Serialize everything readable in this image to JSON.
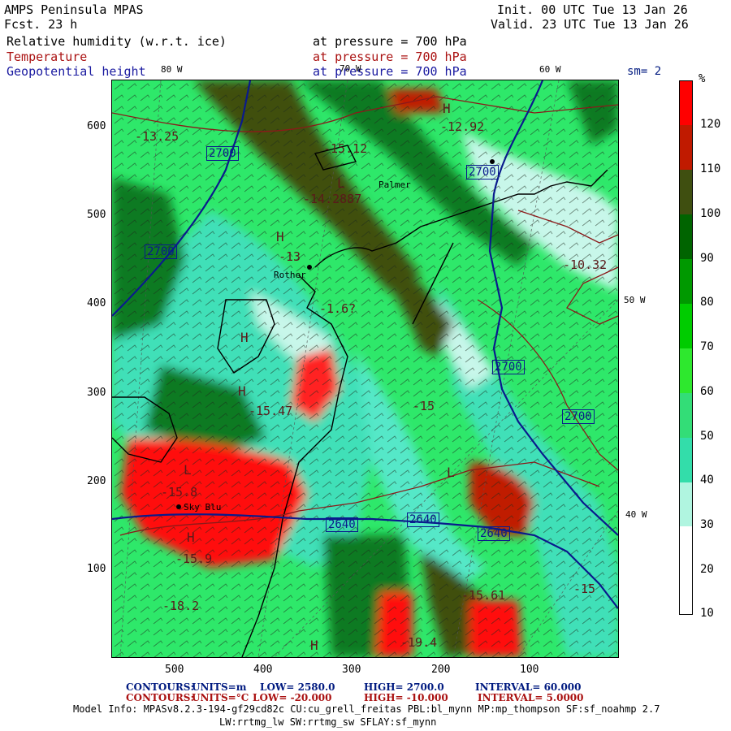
{
  "header": {
    "title": "AMPS Peninsula MPAS",
    "forecast": "Fcst.    23 h",
    "init": "Init. 00 UTC Tue 13 Jan 26",
    "valid": "Valid. 23 UTC Tue 13 Jan 26",
    "sm": "sm= 2"
  },
  "fields": [
    {
      "name": "Relative humidity (w.r.t. ice)",
      "level": "at pressure =  700 hPa",
      "color": "#000000"
    },
    {
      "name": "Temperature",
      "level": "at pressure =  700 hPa",
      "color": "#aa1111"
    },
    {
      "name": "Geopotential height",
      "level": "at pressure =  700 hPa",
      "color": "#1a1aa0"
    }
  ],
  "axes": {
    "x_ticks": [
      "500",
      "400",
      "300",
      "200",
      "100"
    ],
    "y_ticks": [
      "600",
      "500",
      "400",
      "300",
      "200",
      "100"
    ]
  },
  "longitudes": [
    "80 W",
    "70 W",
    "60 W",
    "50 W",
    "40 W"
  ],
  "colorbar": {
    "unit": "%",
    "ticks": [
      "120",
      "110",
      "100",
      "90",
      "80",
      "70",
      "60",
      "50",
      "40",
      "30",
      "20",
      "10"
    ],
    "colors": [
      "#ff0000",
      "#c01a00",
      "#3f4f10",
      "#006400",
      "#009900",
      "#00cc00",
      "#2ee82e",
      "#33dd77",
      "#33ddaa",
      "#b0f5e0",
      "#ffffff",
      "#ffffff"
    ]
  },
  "map_labels": {
    "height_labels": [
      "2700",
      "2700",
      "2700",
      "2700",
      "2700",
      "2640",
      "2640",
      "2640"
    ],
    "temps": [
      "-13.25",
      "-15.12",
      "-14.2887",
      "-13",
      "-12.92",
      "-10.32",
      "-1.6?",
      "-15",
      "-15.9",
      "-18.2",
      "-15.47",
      "-15.8",
      "-15.61",
      "-19.4",
      "-15"
    ],
    "stations": [
      "Palmer",
      "Rother",
      "Sky Blu"
    ],
    "highs_lows": [
      "H",
      "L",
      "H",
      "H",
      "H",
      "L",
      "H",
      "L",
      "H"
    ]
  },
  "footer": {
    "line1_label": "CONTOURS:",
    "line1_units": "UNITS=m",
    "line1_low": "LOW=   2580.0",
    "line1_high": "HIGH=  2700.0",
    "line1_interval": "INTERVAL=   60.000",
    "line2_label": "CONTOURS:",
    "line2_units": "UNITS=°C",
    "line2_low": "LOW= -20.000",
    "line2_high": "HIGH= -10.000",
    "line2_interval": "INTERVAL=   5.0000",
    "model_info": "Model Info: MPASv8.2.3-194-gf29cd82c CU:cu_grell_freitas PBL:bl_mynn MP:mp_thompson SF:sf_noahmp 2.7",
    "model_info2": "LW:rrtmg_lw SW:rrtmg_sw SFLAY:sf_mynn"
  }
}
